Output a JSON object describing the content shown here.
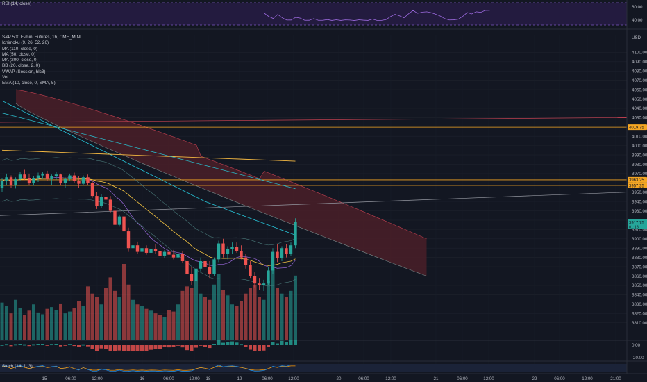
{
  "symbol_title": "S&P 500 E-mini Futures, 1h, CME_MINI",
  "currency": "USD",
  "indicators": [
    "Ichimoku (9, 26, 52, 26)",
    "MA (110, close, 0)",
    "MA (50, close, 0)",
    "MA (200, close, 0)",
    "BB (20, close, 2, 0)",
    "VWAP (Session, hlc3)",
    "Vol",
    "EMA (10, close, 0, SMA, 5)"
  ],
  "rsi": {
    "title": "RSI (14, close)",
    "ticks": [
      "60.00",
      "40.00"
    ]
  },
  "stoch": {
    "title": "Stoch (14, 1, 3)"
  },
  "macd": {
    "ticks": [
      "0.00",
      "-20.00"
    ]
  },
  "price_badges": [
    {
      "value": "4019.75",
      "color": "#f5a623"
    },
    {
      "value": "3963.25",
      "color": "#f5a623"
    },
    {
      "value": "3957.25",
      "color": "#f5a623"
    },
    {
      "value": "3917.75",
      "sub": "01:18",
      "color": "#26a69a"
    }
  ],
  "colors": {
    "up": "#26a69a",
    "down": "#ef5350",
    "background": "#131722",
    "kumo": "#4a1f28",
    "ma_cyan": "#26c6da",
    "ma_yellow": "#f5c542",
    "level_orange": "#f5a623"
  },
  "chart_data": {
    "type": "candlestick",
    "ylim": [
      3800,
      4110
    ],
    "y_ticks": [
      4100,
      4090,
      4080,
      4070,
      4060,
      4050,
      4040,
      4030,
      4020,
      4010,
      4000,
      3990,
      3980,
      3970,
      3960,
      3950,
      3940,
      3930,
      3920,
      3910,
      3900,
      3890,
      3880,
      3870,
      3860,
      3850,
      3840,
      3830,
      3820,
      3810
    ],
    "x_ticks": [
      "15",
      "06:00",
      "12:00",
      "16",
      "06:00",
      "12:00",
      "18",
      "19",
      "06:00",
      "12:00",
      "20",
      "06:00",
      "12:00",
      "21",
      "06:00",
      "12:00",
      "22",
      "06:00",
      "12:00",
      "21:00"
    ],
    "horizontal_levels": [
      4019.75,
      3963.25,
      3957.25
    ],
    "last_price": 3917.75,
    "candles": [
      [
        3955,
        3965,
        3950,
        3962
      ],
      [
        3962,
        3970,
        3958,
        3966
      ],
      [
        3966,
        3968,
        3955,
        3958
      ],
      [
        3958,
        3966,
        3954,
        3964
      ],
      [
        3964,
        3972,
        3962,
        3969
      ],
      [
        3969,
        3974,
        3963,
        3965
      ],
      [
        3965,
        3970,
        3958,
        3960
      ],
      [
        3960,
        3967,
        3957,
        3965
      ],
      [
        3965,
        3971,
        3961,
        3968
      ],
      [
        3968,
        3972,
        3964,
        3970
      ],
      [
        3970,
        3973,
        3962,
        3964
      ],
      [
        3964,
        3969,
        3958,
        3967
      ],
      [
        3967,
        3972,
        3963,
        3969
      ],
      [
        3969,
        3970,
        3958,
        3960
      ],
      [
        3960,
        3966,
        3955,
        3964
      ],
      [
        3964,
        3970,
        3962,
        3968
      ],
      [
        3968,
        3971,
        3960,
        3962
      ],
      [
        3962,
        3967,
        3955,
        3959
      ],
      [
        3959,
        3968,
        3957,
        3966
      ],
      [
        3966,
        3969,
        3958,
        3960
      ],
      [
        3960,
        3962,
        3944,
        3946
      ],
      [
        3946,
        3950,
        3932,
        3935
      ],
      [
        3935,
        3948,
        3933,
        3945
      ],
      [
        3945,
        3952,
        3940,
        3942
      ],
      [
        3942,
        3946,
        3928,
        3930
      ],
      [
        3930,
        3934,
        3912,
        3915
      ],
      [
        3915,
        3926,
        3913,
        3924
      ],
      [
        3924,
        3927,
        3905,
        3908
      ],
      [
        3908,
        3912,
        3886,
        3890
      ],
      [
        3890,
        3896,
        3883,
        3893
      ],
      [
        3893,
        3897,
        3884,
        3886
      ],
      [
        3886,
        3892,
        3882,
        3890
      ],
      [
        3890,
        3893,
        3883,
        3885
      ],
      [
        3885,
        3891,
        3882,
        3889
      ],
      [
        3889,
        3894,
        3884,
        3887
      ],
      [
        3887,
        3890,
        3880,
        3882
      ],
      [
        3882,
        3888,
        3879,
        3886
      ],
      [
        3886,
        3890,
        3880,
        3883
      ],
      [
        3883,
        3888,
        3878,
        3880
      ],
      [
        3880,
        3886,
        3876,
        3884
      ],
      [
        3884,
        3887,
        3874,
        3876
      ],
      [
        3876,
        3880,
        3860,
        3862
      ],
      [
        3862,
        3870,
        3850,
        3855
      ],
      [
        3855,
        3872,
        3852,
        3868
      ],
      [
        3868,
        3880,
        3865,
        3876
      ],
      [
        3876,
        3882,
        3866,
        3870
      ],
      [
        3870,
        3876,
        3858,
        3862
      ],
      [
        3862,
        3880,
        3860,
        3878
      ],
      [
        3878,
        3898,
        3875,
        3895
      ],
      [
        3895,
        3900,
        3880,
        3884
      ],
      [
        3884,
        3892,
        3878,
        3889
      ],
      [
        3889,
        3896,
        3884,
        3891
      ],
      [
        3891,
        3896,
        3885,
        3887
      ],
      [
        3887,
        3893,
        3878,
        3880
      ],
      [
        3880,
        3884,
        3868,
        3872
      ],
      [
        3872,
        3876,
        3858,
        3860
      ],
      [
        3860,
        3864,
        3848,
        3852
      ],
      [
        3852,
        3858,
        3845,
        3850
      ],
      [
        3850,
        3856,
        3844,
        3852
      ],
      [
        3852,
        3870,
        3850,
        3866
      ],
      [
        3866,
        3890,
        3862,
        3886
      ],
      [
        3886,
        3894,
        3875,
        3879
      ],
      [
        3879,
        3892,
        3876,
        3890
      ],
      [
        3890,
        3894,
        3880,
        3884
      ],
      [
        3884,
        3896,
        3882,
        3893
      ],
      [
        3893,
        3922,
        3890,
        3918
      ]
    ],
    "volume": [
      42,
      38,
      30,
      45,
      36,
      28,
      33,
      40,
      31,
      29,
      35,
      37,
      34,
      41,
      30,
      32,
      36,
      44,
      38,
      60,
      52,
      48,
      40,
      58,
      70,
      55,
      48,
      85,
      62,
      45,
      40,
      38,
      35,
      33,
      30,
      28,
      26,
      34,
      32,
      40,
      55,
      60,
      58,
      66,
      52,
      48,
      45,
      62,
      74,
      56,
      50,
      40,
      38,
      44,
      52,
      58,
      62,
      48,
      45,
      66,
      80,
      58,
      52,
      48,
      55,
      72
    ]
  }
}
